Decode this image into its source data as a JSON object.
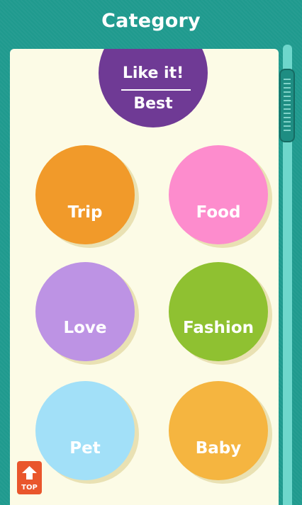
{
  "header": {
    "title": "Category"
  },
  "best": {
    "line1": "Like it!",
    "line2": "Best"
  },
  "categories": [
    {
      "label": "Trip",
      "color": "#f19a2a"
    },
    {
      "label": "Food",
      "color": "#fd8ccd"
    },
    {
      "label": "Love",
      "color": "#bd93e4"
    },
    {
      "label": "Fashion",
      "color": "#8fc131"
    },
    {
      "label": "Pet",
      "color": "#a2e0f8"
    },
    {
      "label": "Baby",
      "color": "#f5b540"
    }
  ],
  "top_button": {
    "label": "TOP",
    "icon": "arrow-up-icon"
  },
  "colors": {
    "background": "#1f9a8e",
    "panel": "#fcfbe6",
    "best": "#6f3a95",
    "top_button": "#e9562c"
  }
}
